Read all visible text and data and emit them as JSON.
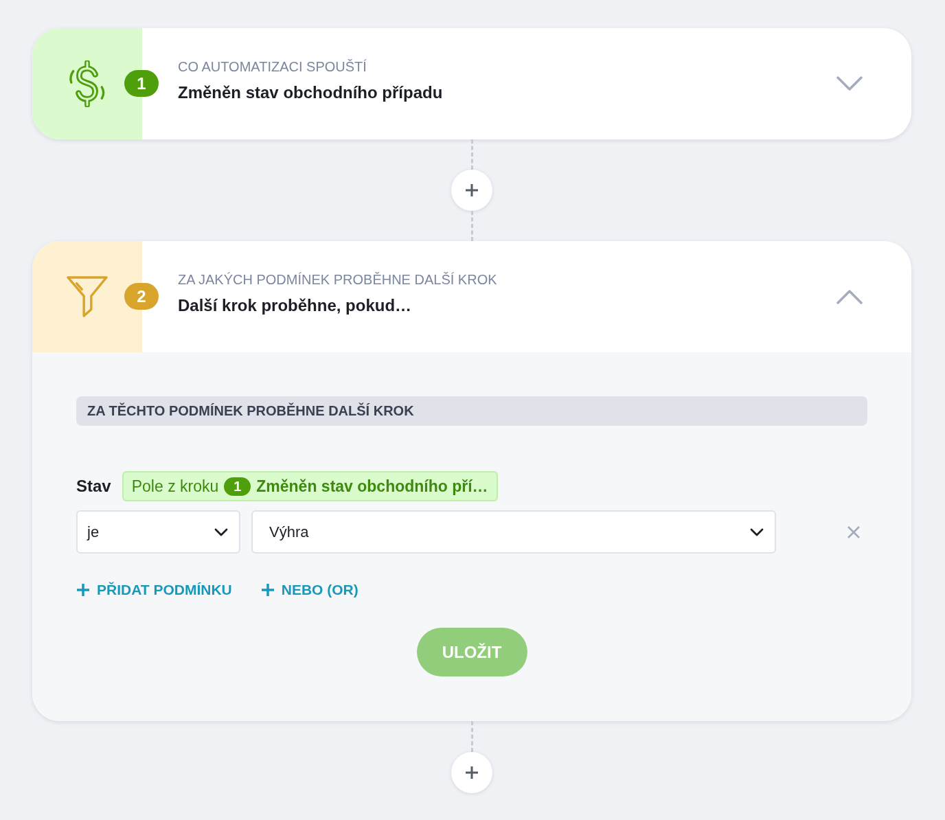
{
  "steps": [
    {
      "kind": "trigger",
      "number": "1",
      "label": "CO AUTOMATIZACI SPOUŠTÍ",
      "title": "Změněn stav obchodního případu",
      "expanded": false
    },
    {
      "kind": "filter",
      "number": "2",
      "label": "ZA JAKÝCH PODMÍNEK PROBĚHNE DALŠÍ KROK",
      "title": "Další krok proběhne, pokud…",
      "expanded": true,
      "panel": {
        "heading": "ZA TĚCHTO PODMÍNEK PROBĚHNE DALŠÍ KROK",
        "conditions": [
          {
            "field": "Stav",
            "source": {
              "prefix": "Pole z kroku",
              "step": "1",
              "name": "Změněn stav obchodního pří…"
            },
            "operator": "je",
            "value": "Výhra"
          }
        ],
        "actions": [
          "PŘIDAT PODMÍNKU",
          "NEBO (OR)"
        ],
        "save_button": {
          "label": "ULOŽIT",
          "disabled": true
        }
      }
    }
  ]
}
